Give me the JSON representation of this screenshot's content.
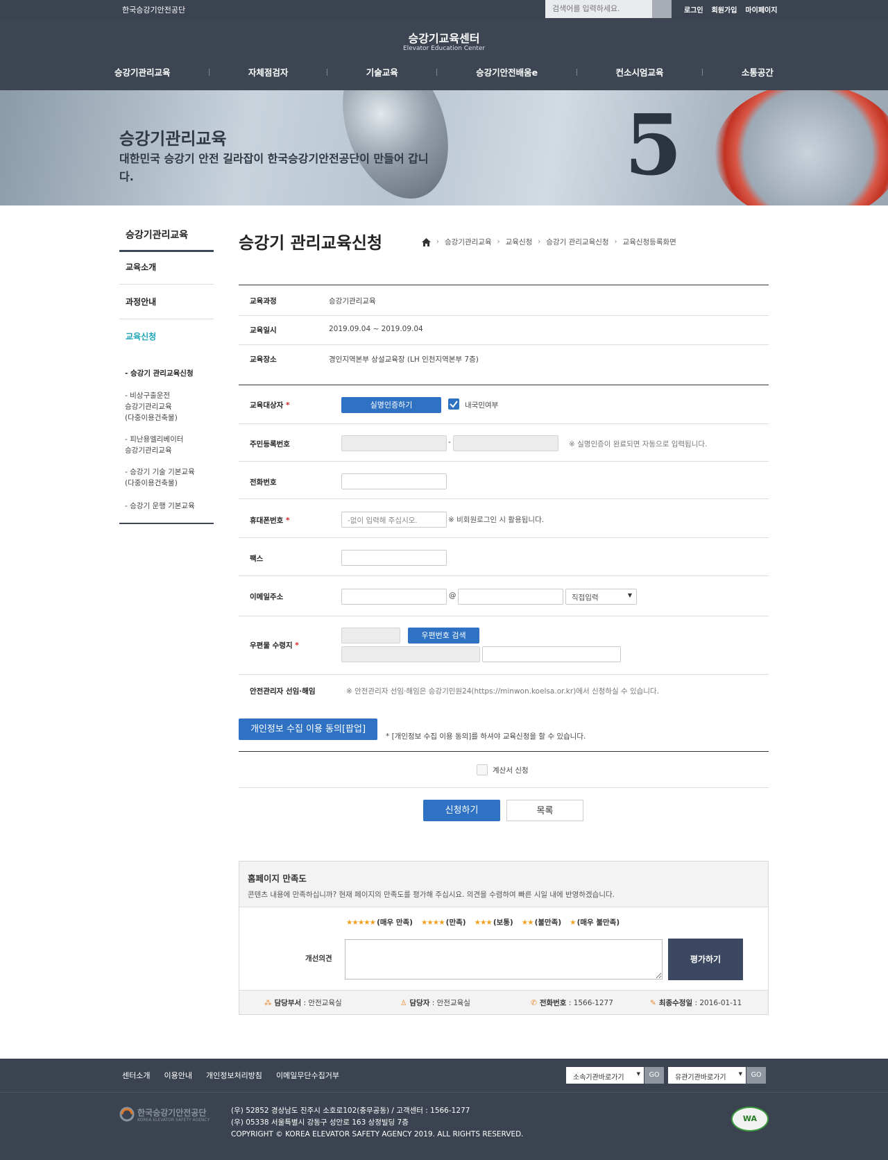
{
  "topbar": {
    "org": "한국승강기안전공단",
    "search_placeholder": "검색어를 입력하세요.",
    "links": [
      "로그인",
      "회원가입",
      "마이페이지"
    ]
  },
  "header": {
    "logo_ko": "승강기교육센터",
    "logo_en": "Elevator Education Center",
    "gnb": [
      "승강기관리교육",
      "자체점검자",
      "기술교육",
      "승강기안전배움e",
      "컨소시엄교육",
      "소통공간"
    ]
  },
  "hero": {
    "title": "승강기관리교육",
    "subtitle": "대한민국 승강기 안전 길라잡이 한국승강기안전공단이 만들어 갑니다.",
    "digit": "5"
  },
  "lnb": {
    "title": "승강기관리교육",
    "items": [
      "교육소개",
      "과정안내",
      "교육신청"
    ],
    "subs": [
      "- 승강기 관리교육신청",
      "- 비상구출운전\n승강기관리교육\n(다중이용건축물)",
      "- 피난용엘리베이터\n승강기관리교육",
      "- 승강기 기술 기본교육\n(다중이용건축물)",
      "- 승강기 운행 기본교육"
    ]
  },
  "main": {
    "title": "승강기 관리교육신청",
    "breadcrumb": [
      "승강기관리교육",
      "교육신청",
      "승강기 관리교육신청",
      "교육신청등록화면"
    ],
    "info": [
      {
        "label": "교육과정",
        "value": "승강기관리교육"
      },
      {
        "label": "교육일시",
        "value": "2019.09.04 ~ 2019.09.04"
      },
      {
        "label": "교육장소",
        "value": "경인지역본부 상설교육장 (LH 인천지역본부 7층)"
      }
    ],
    "form": {
      "target_label": "교육대상자",
      "auth_button": "실명인증하기",
      "domestic_label": "내국민여부",
      "rrn_label": "주민등록번호",
      "rrn_note": "※ 실명인증이 완료되면 자동으로 입력됩니다.",
      "phone_label": "전화번호",
      "mobile_label": "휴대폰번호",
      "mobile_placeholder": "-없이 입력해 주십시오.",
      "mobile_note": "※ 비회원로그인 시 활용됩니다.",
      "fax_label": "팩스",
      "email_label": "이메일주소",
      "email_at": "@",
      "email_select": "직접입력",
      "post_label": "우편물 수령지",
      "zip_button": "우편번호 검색",
      "manager_label": "안전관리자 선임·해임",
      "manager_note": "※ 안전관리자 선임·해임은 승강기민원24(https://minwon.koelsa.or.kr)에서 신청하실 수 있습니다.",
      "privacy_button": "개인정보 수집 이용 동의[팝업]",
      "privacy_note": "* [개인정보 수집 이용 동의]를 하셔야 교육신청을 할 수 있습니다.",
      "invoice_label": "계산서 신청",
      "submit_button": "신청하기",
      "list_button": "목록"
    }
  },
  "satisfaction": {
    "title": "홈페이지 만족도",
    "desc": "콘텐츠 내용에 만족하십니까? 현재 페이지의 만족도를 평가해 주십시요. 의견을 수렴하여 빠른 시일 내에 반영하겠습니다.",
    "ratings": [
      {
        "stars": "★★★★★",
        "label": "(매우 만족)"
      },
      {
        "stars": "★★★★",
        "label": "(만족)"
      },
      {
        "stars": "★★★",
        "label": "(보통)"
      },
      {
        "stars": "★★",
        "label": "(불만족)"
      },
      {
        "stars": "★",
        "label": "(매우 불만족)"
      }
    ],
    "comment_label": "개선의견",
    "submit": "평가하기",
    "dept_label": "담당부서",
    "dept": " : 안전교육실",
    "person_label": "담당자",
    "person": " : 안전교육실",
    "tel_label": "전화번호",
    "tel": " : 1566-1277",
    "updated_label": "최종수정일",
    "updated": " : 2016-01-11"
  },
  "footer": {
    "links": [
      "센터소개",
      "이용안내",
      "개인정보처리방침",
      "이메일무단수집거부"
    ],
    "select1": "소속기관바로가기",
    "select2": "유관기관바로가기",
    "go": "GO",
    "logo": "한국승강기안전공단",
    "logo_en": "KOREA ELEVATOR SAFETY AGENCY",
    "addr1": "(우) 52852 경상남도 진주시 소호로102(충무공동) / 고객센터 : 1566-1277",
    "addr2": "(우) 05338 서울특별시 강동구 성안로 163 상정빌딩 7층",
    "copyright": "COPYRIGHT © KOREA ELEVATOR SAFETY AGENCY 2019. ALL RIGHTS RESERVED.",
    "wa_mark": "WA"
  }
}
